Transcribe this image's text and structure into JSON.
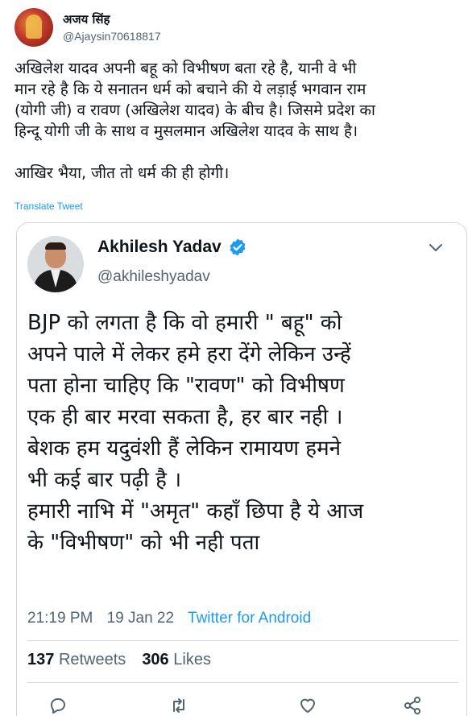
{
  "outer_tweet": {
    "author_name": "अजय सिंह",
    "author_handle": "@Ajaysin70618817",
    "text_lines": [
      "अखिलेश यादव अपनी बहू को विभीषण बता रहे है, यानी वे भी",
      "मान रहे है कि ये सनातन धर्म को बचाने की ये लड़ाई भगवान राम",
      "(योगी जी) व रावण (अखिलेश यादव) के बीच है। जिसमे प्रदेश का",
      "हिन्दू योगी जी के साथ व मुसलमान अखिलेश यादव के साथ है।"
    ],
    "text_closing": "आखिर भैया, जीत तो धर्म की ही होगी।",
    "translate_label": "Translate Tweet"
  },
  "quoted_tweet": {
    "author_name": "Akhilesh Yadav",
    "author_handle": "@akhileshyadav",
    "verified": true,
    "text_lines": [
      "BJP को लगता है कि वो हमारी \" बहू\" को",
      "अपने पाले में लेकर हमे हरा देंगे लेकिन उन्हें",
      "पता होना चाहिए कि \"रावण\" को विभीषण",
      "एक ही बार मरवा सकता है, हर बार नही ।",
      "बेशक हम यदुवंशी हैं लेकिन रामायण हमने",
      "भी कई बार पढ़ी है ।",
      "हमारी नाभि में \"अमृत\" कहाँ छिपा है ये आज",
      "के \"विभीषण\" को भी नही पता"
    ],
    "time": "21:19 PM",
    "date": "19 Jan 22",
    "source": "Twitter for Android",
    "retweets_count": "137",
    "retweets_label": "Retweets",
    "likes_count": "306",
    "likes_label": "Likes"
  },
  "colors": {
    "link_blue": "#1d9bf0",
    "secondary_text": "#536471",
    "border": "#cfd9de"
  },
  "icons": [
    "verified-badge-icon",
    "chevron-down-icon",
    "reply-icon",
    "retweet-icon",
    "like-icon",
    "share-icon"
  ]
}
